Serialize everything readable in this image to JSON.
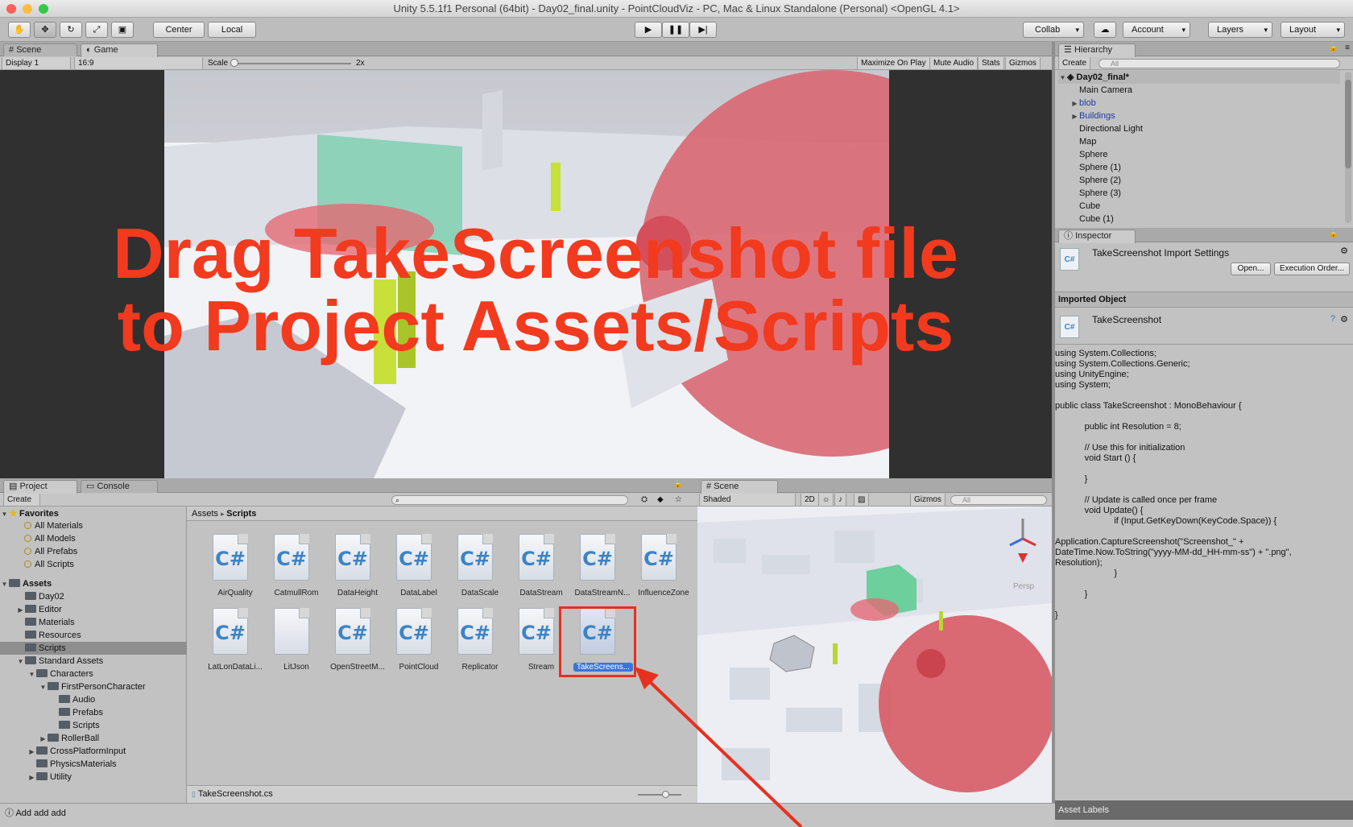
{
  "window": {
    "title": "Unity 5.5.1f1 Personal (64bit) - Day02_final.unity - PointCloudViz - PC, Mac & Linux Standalone (Personal) <OpenGL 4.1>"
  },
  "toolbar": {
    "tools": [
      "hand-icon",
      "move-icon",
      "rotate-icon",
      "scale-icon",
      "rect-icon"
    ],
    "pivot": "Center",
    "space": "Local",
    "collab": "Collab",
    "account": "Account",
    "layers": "Layers",
    "layout": "Layout"
  },
  "game_panel": {
    "tabs": [
      "Scene",
      "Game"
    ],
    "display": "Display 1",
    "aspect": "16:9",
    "scale_label": "Scale",
    "scale_value": "2x",
    "buttons": [
      "Maximize On Play",
      "Mute Audio",
      "Stats",
      "Gizmos"
    ]
  },
  "overlay": {
    "line1": "Drag TakeScreenshot file",
    "line2": "to Project Assets/Scripts"
  },
  "hierarchy": {
    "tab": "Hierarchy",
    "create": "Create",
    "search_placeholder": "All",
    "scene": "Day02_final*",
    "items": [
      "Main Camera",
      "blob",
      "Buildings",
      "Directional Light",
      "Map",
      "Sphere",
      "Sphere (1)",
      "Sphere (2)",
      "Sphere (3)",
      "Cube",
      "Cube (1)"
    ]
  },
  "inspector": {
    "tab": "Inspector",
    "title": "TakeScreenshot Import Settings",
    "open": "Open...",
    "exec": "Execution Order...",
    "imported_header": "Imported Object",
    "object_name": "TakeScreenshot",
    "asset_labels": "Asset Labels",
    "code": "using System.Collections;\nusing System.Collections.Generic;\nusing UnityEngine;\nusing System;\n\npublic class TakeScreenshot : MonoBehaviour {\n\n            public int Resolution = 8;\n\n            // Use this for initialization\n            void Start () {\n\n            }\n\n            // Update is called once per frame\n            void Update() {\n                        if (Input.GetKeyDown(KeyCode.Space)) {\n\nApplication.CaptureScreenshot(\"Screenshot_\" +\nDateTime.Now.ToString(\"yyyy-MM-dd_HH-mm-ss\") + \".png\",\nResolution);\n                        }\n\n            }\n\n}"
  },
  "project": {
    "tabs": [
      "Project",
      "Console"
    ],
    "create": "Create",
    "breadcrumb_root": "Assets",
    "breadcrumb_current": "Scripts",
    "favorites_label": "Favorites",
    "favorites": [
      "All Materials",
      "All Models",
      "All Prefabs",
      "All Scripts"
    ],
    "assets_label": "Assets",
    "tree": [
      {
        "label": "Day02",
        "indent": 1,
        "arrow": ""
      },
      {
        "label": "Editor",
        "indent": 1,
        "arrow": "▶"
      },
      {
        "label": "Materials",
        "indent": 1,
        "arrow": ""
      },
      {
        "label": "Resources",
        "indent": 1,
        "arrow": ""
      },
      {
        "label": "Scripts",
        "indent": 1,
        "arrow": "",
        "selected": true
      },
      {
        "label": "Standard Assets",
        "indent": 1,
        "arrow": "▼"
      },
      {
        "label": "Characters",
        "indent": 2,
        "arrow": "▼"
      },
      {
        "label": "FirstPersonCharacter",
        "indent": 3,
        "arrow": "▼"
      },
      {
        "label": "Audio",
        "indent": 4,
        "arrow": ""
      },
      {
        "label": "Prefabs",
        "indent": 4,
        "arrow": ""
      },
      {
        "label": "Scripts",
        "indent": 4,
        "arrow": ""
      },
      {
        "label": "RollerBall",
        "indent": 3,
        "arrow": "▶"
      },
      {
        "label": "CrossPlatformInput",
        "indent": 2,
        "arrow": "▶"
      },
      {
        "label": "PhysicsMaterials",
        "indent": 2,
        "arrow": ""
      },
      {
        "label": "Utility",
        "indent": 2,
        "arrow": "▶"
      }
    ],
    "files": [
      "AirQuality",
      "CatmullRom",
      "DataHeight",
      "DataLabel",
      "DataScale",
      "DataStream",
      "DataStreamN...",
      "InfluenceZone",
      "LatLonDataLi...",
      "LitJson",
      "OpenStreetM...",
      "PointCloud",
      "Replicator",
      "Stream",
      "TakeScreens..."
    ],
    "selected_file": "TakeScreenshot.cs",
    "status": "Add add add"
  },
  "scene_panel": {
    "tab": "Scene",
    "shading": "Shaded",
    "mode_2d": "2D",
    "gizmos": "Gizmos",
    "search_placeholder": "All",
    "persp": "Persp"
  },
  "colors": {
    "accent_red": "#f23a1f",
    "selection_blue": "#3c74d8"
  }
}
